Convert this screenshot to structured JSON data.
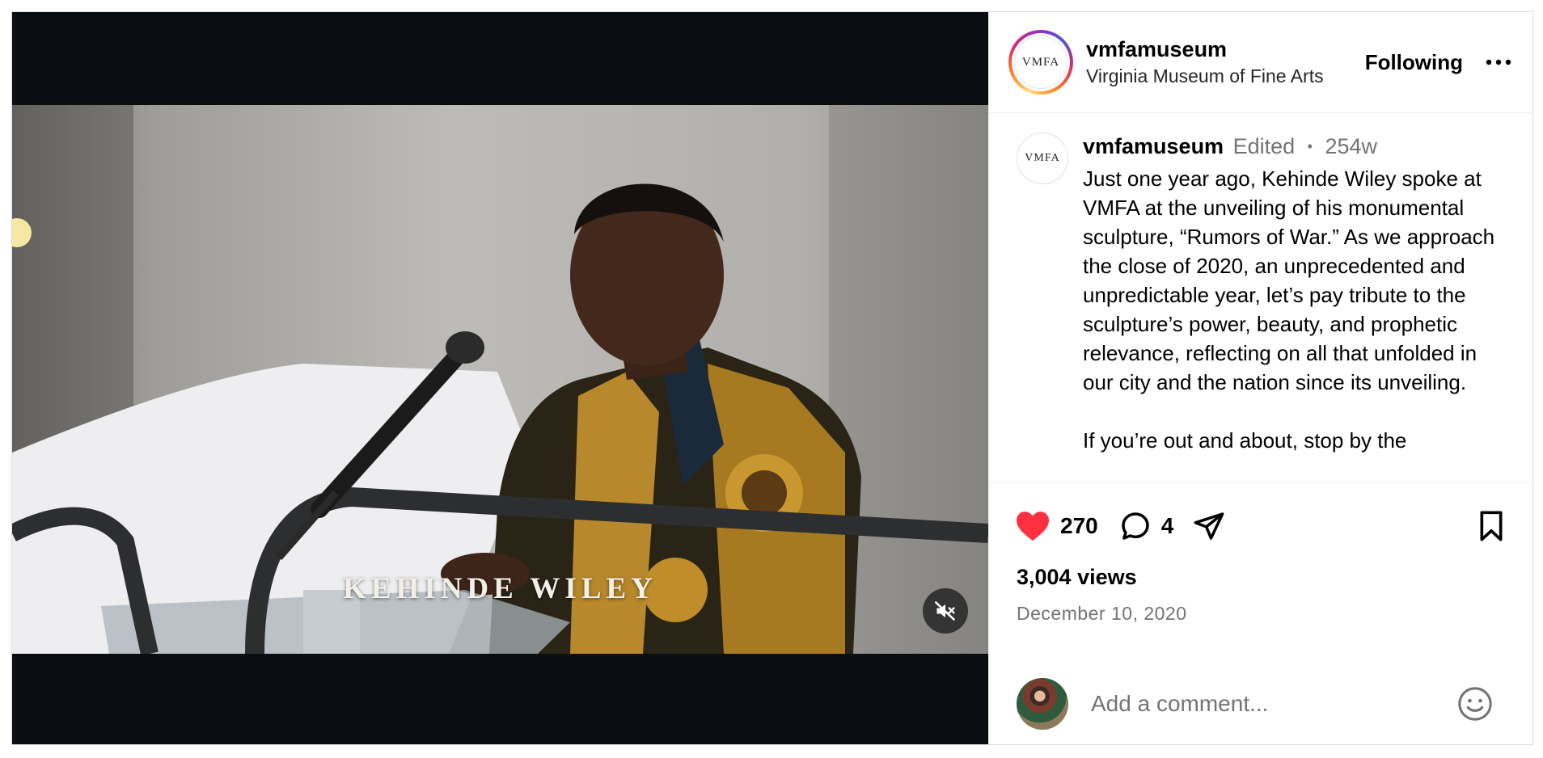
{
  "post": {
    "username": "vmfamuseum",
    "subtitle": "Virginia Museum of Fine Arts",
    "follow_label": "Following",
    "logo_text": "VMFA"
  },
  "video": {
    "caption_overlay": "KEHINDE WILEY",
    "muted": true
  },
  "caption": {
    "username": "vmfamuseum",
    "edited_label": "Edited",
    "separator": "•",
    "time_ago": "254w",
    "text": "Just one year ago, Kehinde Wiley spoke at VMFA at the unveiling of his monumental sculpture, “Rumors of War.” As we approach the close of 2020, an unprecedented and unpredictable year, let’s pay tribute to the sculpture’s power, beauty, and prophetic relevance, reflecting on all that unfolded in our city and the nation since its unveiling.\n\nIf you’re out and about, stop by the"
  },
  "stats": {
    "likes": "270",
    "comments": "4",
    "views": "3,004 views",
    "date": "December 10, 2020"
  },
  "comment_box": {
    "placeholder": "Add a comment..."
  },
  "icons": {
    "like": "heart-filled-icon",
    "comment": "comment-bubble-icon",
    "share": "paper-plane-icon",
    "save": "bookmark-icon",
    "more": "ellipsis-icon",
    "mute": "speaker-muted-icon",
    "emoji": "smiley-icon"
  },
  "colors": {
    "like_red": "#ff3040",
    "muted_text": "#737373",
    "video_bar": "#0a0e13"
  }
}
